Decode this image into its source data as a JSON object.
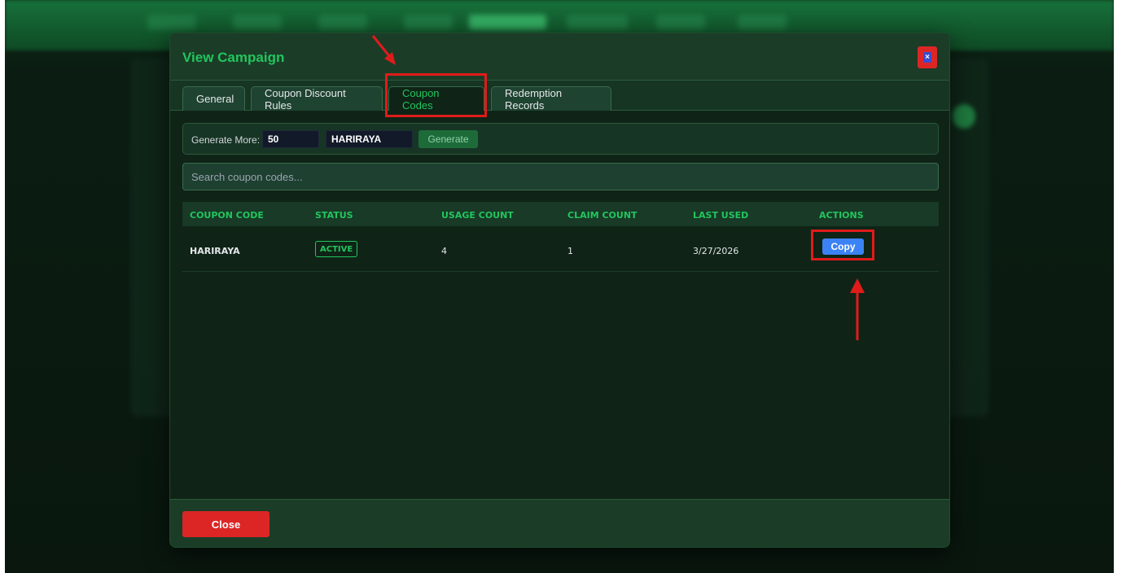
{
  "modal": {
    "title": "View Campaign",
    "close_icon_glyph": "×"
  },
  "tabs": [
    {
      "label": "General",
      "active": false
    },
    {
      "label": "Coupon Discount Rules",
      "active": false
    },
    {
      "label": "Coupon Codes",
      "active": true
    },
    {
      "label": "Redemption Records",
      "active": false
    }
  ],
  "generator": {
    "label": "Generate More:",
    "quantity": "50",
    "prefix": "HARIRAYA",
    "button_label": "Generate"
  },
  "search": {
    "placeholder": "Search coupon codes..."
  },
  "table": {
    "headers": {
      "code": "COUPON CODE",
      "status": "STATUS",
      "usage": "USAGE COUNT",
      "claim": "CLAIM COUNT",
      "last_used": "LAST USED",
      "actions": "ACTIONS"
    },
    "rows": [
      {
        "code": "HARIRAYA",
        "status": "ACTIVE",
        "usage": "4",
        "claim": "1",
        "last_used": "3/27/2026",
        "action_label": "Copy"
      }
    ]
  },
  "footer": {
    "close_label": "Close"
  },
  "colors": {
    "accent": "#22c55e",
    "danger": "#dc2626",
    "primary": "#3b82f6",
    "annotation": "#e01b1b"
  }
}
